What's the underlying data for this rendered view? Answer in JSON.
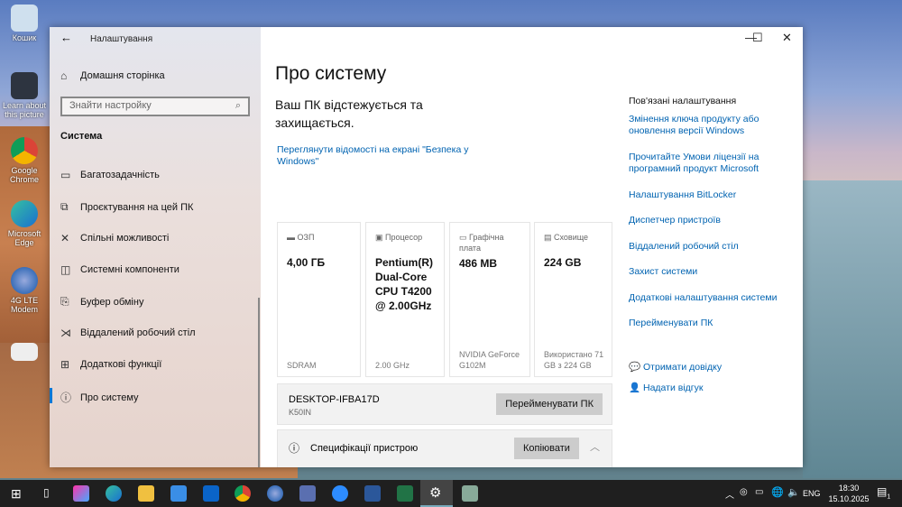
{
  "desktop": {
    "icons": [
      "Кошик",
      "Learn about this picture",
      "Google Chrome",
      "Microsoft Edge",
      "4G LTE Modem"
    ]
  },
  "window": {
    "app_title": "Налаштування"
  },
  "sidebar": {
    "home": "Домашня сторінка",
    "search_placeholder": "Знайти настройку",
    "section": "Система",
    "items": [
      {
        "label": "Багатозадачність"
      },
      {
        "label": "Проєктування на цей ПК"
      },
      {
        "label": "Спільні можливості"
      },
      {
        "label": "Системні компоненти"
      },
      {
        "label": "Буфер обміну"
      },
      {
        "label": "Віддалений робочий стіл"
      },
      {
        "label": "Додаткові функції"
      },
      {
        "label": "Про систему"
      }
    ]
  },
  "main": {
    "title": "Про систему",
    "protection": "Ваш ПК відстежується та захищається.",
    "security_link": "Переглянути відомості на екрані \"Безпека у Windows\"",
    "cards": [
      {
        "label": "ОЗП",
        "value": "4,00 ГБ",
        "sub": "SDRAM"
      },
      {
        "label": "Процесор",
        "value": "Pentium(R) Dual-Core CPU T4200 @ 2.00GHz",
        "sub": "2.00 GHz"
      },
      {
        "label": "Графічна плата",
        "value": "486 MB",
        "sub": "NVIDIA GeForce G102M"
      },
      {
        "label": "Сховище",
        "value": "224 GB",
        "sub": "Використано 71 GB з 224 GB"
      }
    ],
    "pc_name": "DESKTOP-IFBA17D",
    "pc_model": "K50IN",
    "rename_button": "Перейменувати ПК",
    "specs_label": "Специфікації пристрою",
    "copy_button": "Копіювати"
  },
  "related": {
    "title": "Пов'язані налаштування",
    "links": [
      "Змінення ключа продукту або оновлення версії Windows",
      "Прочитайте Умови ліцензії на програмний продукт Microsoft",
      "Налаштування BitLocker",
      "Диспетчер пристроїв",
      "Віддалений робочий стіл",
      "Захист системи",
      "Додаткові налаштування системи",
      "Перейменувати ПК"
    ],
    "help": "Отримати довідку",
    "feedback": "Надати відгук"
  },
  "taskbar": {
    "language": "ENG",
    "time": "18:30",
    "date": "15.10.2025",
    "notifications": "1"
  }
}
